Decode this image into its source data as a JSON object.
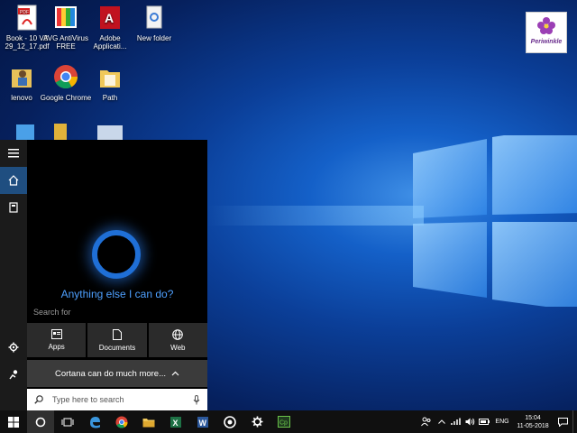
{
  "desktop": {
    "icons": [
      {
        "label": "Book - 10 V3 29_12_17.pdf",
        "icon": "pdf-file-icon"
      },
      {
        "label": "AVG AntiVirus FREE",
        "icon": "avg-antivirus-icon"
      },
      {
        "label": "Adobe Applicati...",
        "icon": "adobe-reader-icon"
      },
      {
        "label": "New folder",
        "icon": "folder-icon"
      },
      {
        "label": "lenovo",
        "icon": "user-folder-icon"
      },
      {
        "label": "Google Chrome",
        "icon": "chrome-icon"
      },
      {
        "label": "Path",
        "icon": "folder-icon"
      }
    ],
    "watermark": "Periwinkle"
  },
  "cortana": {
    "prompt": "Anything else I can do?",
    "search_for_label": "Search for",
    "tiles": [
      {
        "label": "Apps",
        "icon": "apps-icon"
      },
      {
        "label": "Documents",
        "icon": "document-icon"
      },
      {
        "label": "Web",
        "icon": "globe-icon"
      }
    ],
    "more_label": "Cortana can do much more...",
    "search_placeholder": "Type here to search"
  },
  "taskbar": {
    "apps": [
      "start-icon",
      "cortana-icon",
      "task-view-icon",
      "edge-icon",
      "chrome-icon",
      "file-explorer-icon",
      "excel-icon",
      "word-icon",
      "media-icon",
      "settings-icon",
      "camtasia-icon"
    ],
    "tray": {
      "language": "ENG",
      "time": "15:04",
      "date": "11-05-2018"
    }
  },
  "colors": {
    "accent": "#1f6fd6",
    "cortana_text": "#4ea0ff",
    "taskbar": "#101010"
  }
}
